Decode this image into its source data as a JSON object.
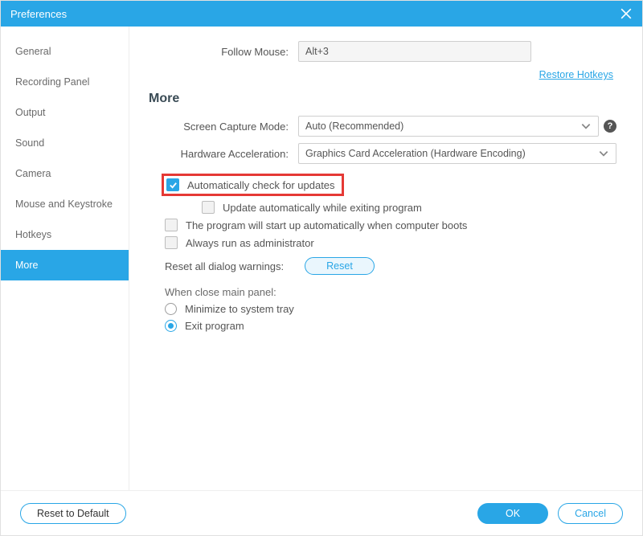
{
  "title": "Preferences",
  "sidebar": {
    "items": [
      {
        "label": "General"
      },
      {
        "label": "Recording Panel"
      },
      {
        "label": "Output"
      },
      {
        "label": "Sound"
      },
      {
        "label": "Camera"
      },
      {
        "label": "Mouse and Keystroke"
      },
      {
        "label": "Hotkeys"
      },
      {
        "label": "More"
      }
    ],
    "activeIndex": 7
  },
  "followMouse": {
    "label": "Follow Mouse:",
    "value": "Alt+3"
  },
  "restoreLink": "Restore Hotkeys",
  "sectionTitle": "More",
  "screenCapture": {
    "label": "Screen Capture Mode:",
    "value": "Auto (Recommended)"
  },
  "hwAccel": {
    "label": "Hardware Acceleration:",
    "value": "Graphics Card Acceleration (Hardware Encoding)"
  },
  "checks": {
    "auto_update": "Automatically check for updates",
    "update_on_exit": "Update automatically while exiting program",
    "start_on_boot": "The program will start up automatically when computer boots",
    "run_admin": "Always run as administrator"
  },
  "resetDialogs": {
    "label": "Reset all dialog warnings:",
    "button": "Reset"
  },
  "closePanel": {
    "label": "When close main panel:",
    "minimize": "Minimize to system tray",
    "exit": "Exit program"
  },
  "footer": {
    "resetDefault": "Reset to Default",
    "ok": "OK",
    "cancel": "Cancel"
  },
  "helpTooltip": "?"
}
